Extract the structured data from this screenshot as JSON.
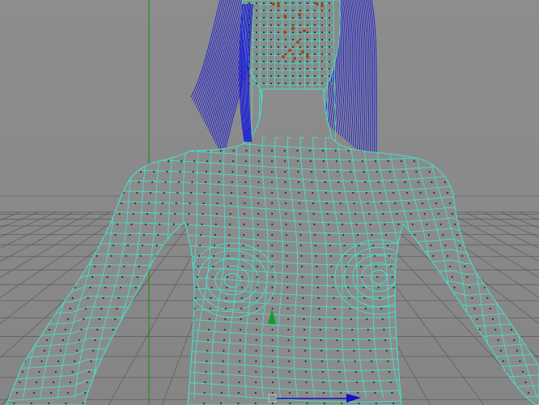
{
  "viewport": {
    "background_color": "#8a8a8a",
    "grid_line_color": "#5f5f5f",
    "horizon_color": "#6c6c6c",
    "y_axis_color": "#1f8f1f",
    "wireframe_color": "#45e0cc",
    "vertex_color": "#1f3a2a",
    "hair_color": "#1a1ad8",
    "face_vertex_color": "#b04010",
    "pivot_up_color": "#10a020",
    "pivot_right_color": "#1010c8"
  },
  "icons": {
    "transform_manipulator": "move-manipulator-icon",
    "pivot": "pivot-icon"
  }
}
